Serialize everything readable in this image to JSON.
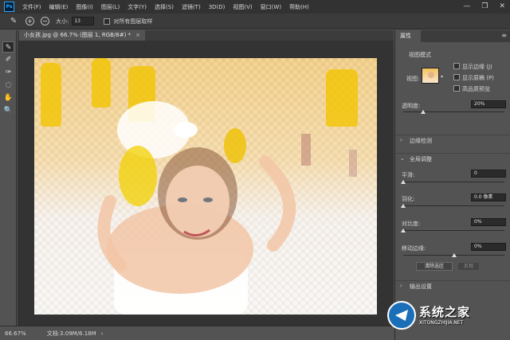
{
  "app": {
    "logo_text": "Ps"
  },
  "menu": [
    "文件(F)",
    "编辑(E)",
    "图像(I)",
    "图层(L)",
    "文字(Y)",
    "选择(S)",
    "滤镜(T)",
    "3D(D)",
    "视图(V)",
    "窗口(W)",
    "帮助(H)"
  ],
  "window_controls": {
    "minimize": "—",
    "restore": "❐",
    "close": "✕"
  },
  "options_bar": {
    "brush_tool_icon": "refine-brush-icon",
    "plus": "+",
    "minus": "−",
    "size_label": "大小:",
    "size_value": "13",
    "sample_all_layers": "对所有图层取样"
  },
  "document_tab": {
    "title": "小女孩.jpg @ 66.7% (图层 1, RGB/8#) *",
    "close": "×"
  },
  "tools": [
    "✎",
    "✐",
    "✑",
    "◌",
    "✋",
    "🔍"
  ],
  "status": {
    "zoom": "66.67%",
    "doc_info": "文档:3.09M/6.18M",
    "arrow": "›"
  },
  "panel": {
    "tab": "属性",
    "menu": "≡",
    "view_mode": {
      "title": "视图模式",
      "view_label": "视图:",
      "options": [
        {
          "label": "显示边缘 (J)",
          "checked": false
        },
        {
          "label": "显示原稿 (P)",
          "checked": false
        },
        {
          "label": "高品质预览",
          "checked": false
        }
      ]
    },
    "opacity": {
      "label": "透明度:",
      "value": "20%",
      "level": 0.2
    },
    "edge_detection": {
      "caret": "›",
      "title": "边缘检测"
    },
    "global_refinement": {
      "caret": "⌄",
      "title": "全局调整",
      "smooth": {
        "label": "平滑:",
        "value": "0",
        "level": 0
      },
      "feather": {
        "label": "羽化:",
        "value": "0.0 像素",
        "level": 0
      },
      "contrast": {
        "label": "对比度:",
        "value": "0%",
        "level": 0
      },
      "shift_edge": {
        "label": "移动边缘:",
        "value": "0%",
        "level": 0.5
      },
      "clear_selection": "清除选区",
      "invert": "反相"
    },
    "output_settings": {
      "caret": "›",
      "title": "输出设置"
    }
  },
  "watermark": {
    "title": "系统之家",
    "url": "XITONGZHIJIA.NET"
  },
  "colors": {
    "menubar": "#323232",
    "panel": "#535353",
    "canvas": "#333333",
    "accent": "#31a8ff"
  }
}
